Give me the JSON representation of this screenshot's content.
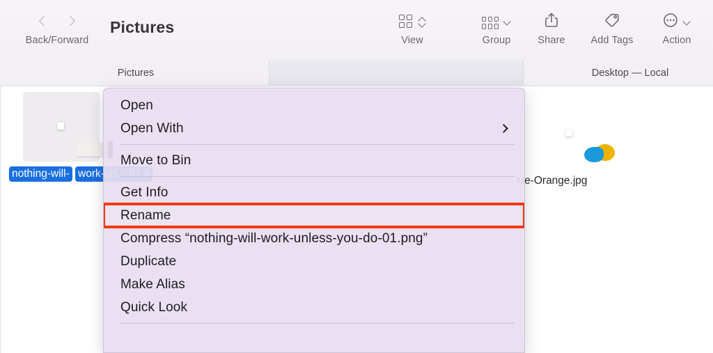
{
  "toolbar": {
    "nav_label": "Back/Forward",
    "back_icon": "chevron-left-icon",
    "forward_icon": "chevron-right-icon",
    "folder_title": "Pictures",
    "buttons": [
      {
        "label": "View",
        "icon": "grid-view-icon"
      },
      {
        "label": "Group",
        "icon": "group-rows-icon"
      },
      {
        "label": "Share",
        "icon": "share-upload-icon"
      },
      {
        "label": "Add Tags",
        "icon": "tag-icon"
      },
      {
        "label": "Action",
        "icon": "ellipsis-circle-icon"
      }
    ]
  },
  "tabs": [
    {
      "label": "Pictures",
      "active": false
    },
    {
      "label": "",
      "active": true
    },
    {
      "label": "Desktop — Local",
      "active": false
    }
  ],
  "files": [
    {
      "name_line1": "nothing-will-",
      "name_line2": "work-un...-01.p",
      "selected": true,
      "thumb": "note-photo-thumbnail"
    },
    {
      "name_line1": "lue-Orange.jpg",
      "name_line2": "",
      "selected": false,
      "thumb": "blue-orange-photo-thumbnail"
    }
  ],
  "context_menu": {
    "items": [
      {
        "label": "Open",
        "submenu": false,
        "separator_after": false,
        "highlighted": false
      },
      {
        "label": "Open With",
        "submenu": true,
        "separator_after": true,
        "highlighted": false
      },
      {
        "label": "Move to Bin",
        "submenu": false,
        "separator_after": true,
        "highlighted": false
      },
      {
        "label": "Get Info",
        "submenu": false,
        "separator_after": false,
        "highlighted": false
      },
      {
        "label": "Rename",
        "submenu": false,
        "separator_after": false,
        "highlighted": true
      },
      {
        "label": "Compress “nothing-will-work-unless-you-do-01.png”",
        "submenu": false,
        "separator_after": false,
        "highlighted": false
      },
      {
        "label": "Duplicate",
        "submenu": false,
        "separator_after": false,
        "highlighted": false
      },
      {
        "label": "Make Alias",
        "submenu": false,
        "separator_after": false,
        "highlighted": false
      },
      {
        "label": "Quick Look",
        "submenu": false,
        "separator_after": true,
        "highlighted": false
      }
    ]
  },
  "colors": {
    "highlight_red": "#ef3b18",
    "selection_blue": "#1a6fe0",
    "toolbar_bg": "#f5f2f6",
    "menu_bg": "#e8def0"
  }
}
